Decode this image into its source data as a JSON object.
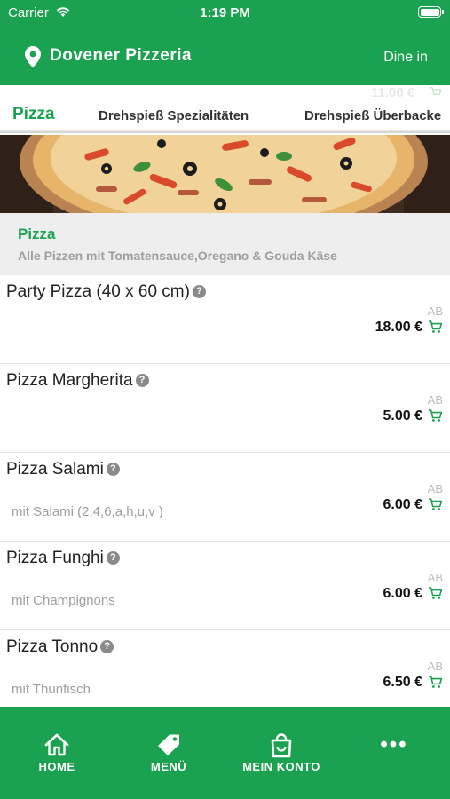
{
  "status_bar": {
    "carrier": "Carrier",
    "time": "1:19 PM"
  },
  "header": {
    "restaurant_name": "Dovener Pizzeria",
    "mode": "Dine in"
  },
  "ghost_price": "11.00 €",
  "category_tabs": [
    {
      "label": "Pizza",
      "active": true
    },
    {
      "label": "Drehspieß Spezialitäten",
      "active": false
    },
    {
      "label": "Drehspieß Überbacke",
      "active": false
    }
  ],
  "category": {
    "title": "Pizza",
    "description": "Alle Pizzen mit Tomatensauce,Oregano & Gouda Käse"
  },
  "items": [
    {
      "name": "Party Pizza (40 x 60 cm)",
      "description": "",
      "prefix": "AB",
      "price": "18.00 €"
    },
    {
      "name": "Pizza Margherita",
      "description": "",
      "prefix": "AB",
      "price": "5.00 €"
    },
    {
      "name": "Pizza Salami",
      "description": "mit Salami (2,4,6,a,h,u,v )",
      "prefix": "AB",
      "price": "6.00 €"
    },
    {
      "name": "Pizza Funghi",
      "description": "mit Champignons",
      "prefix": "AB",
      "price": "6.00 €"
    },
    {
      "name": "Pizza Tonno",
      "description": "mit Thunfisch",
      "prefix": "AB",
      "price": "6.50 €"
    }
  ],
  "tab_bar": {
    "home": "HOME",
    "menu": "MENÜ",
    "account": "MEIN KONTO",
    "more": "•••"
  },
  "colors": {
    "brand_green": "#1aa251",
    "category_bg": "#eeeeee"
  },
  "icons": {
    "header": "map-pin-icon",
    "item_info": "question-icon",
    "item_cart": "cart-icon",
    "tabs": [
      "home-icon",
      "tag-icon",
      "shopping-bag-icon",
      "more-icon"
    ]
  }
}
